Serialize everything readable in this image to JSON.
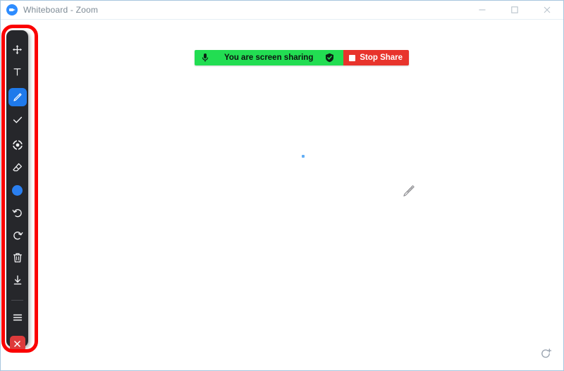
{
  "window": {
    "title": "Whiteboard - Zoom",
    "app_icon": "zoom-logo-icon",
    "controls": [
      {
        "name": "minimize",
        "glyph": "minimize-icon"
      },
      {
        "name": "maximize",
        "glyph": "maximize-icon"
      },
      {
        "name": "close",
        "glyph": "close-icon"
      }
    ]
  },
  "share_banner": {
    "mic_icon": "microphone-icon",
    "status_text": "You are screen sharing",
    "shield_icon": "shield-check-icon",
    "stop_icon": "stop-square-icon",
    "stop_label": "Stop Share",
    "green": "#22dd52",
    "red": "#e8342c"
  },
  "toolbar": {
    "highlight_color": "#fb0000",
    "active_color": "#1f7aeb",
    "current_color": "#2a7ff0",
    "items": [
      {
        "id": "select",
        "label": "Select",
        "icon": "move-icon",
        "active": false
      },
      {
        "id": "text",
        "label": "Text",
        "icon": "text-icon",
        "active": false
      },
      {
        "id": "draw",
        "label": "Draw",
        "icon": "pencil-icon",
        "active": true
      },
      {
        "id": "stamp",
        "label": "Stamp",
        "icon": "check-icon",
        "active": false
      },
      {
        "id": "spotlight",
        "label": "Spotlight",
        "icon": "spotlight-icon",
        "active": false
      },
      {
        "id": "eraser",
        "label": "Eraser",
        "icon": "eraser-icon",
        "active": false
      },
      {
        "id": "format",
        "label": "Format",
        "icon": "color-dot-icon",
        "active": false
      },
      {
        "id": "undo",
        "label": "Undo",
        "icon": "undo-icon",
        "active": false
      },
      {
        "id": "redo",
        "label": "Redo",
        "icon": "redo-icon",
        "active": false
      },
      {
        "id": "clear",
        "label": "Clear",
        "icon": "trash-icon",
        "active": false
      },
      {
        "id": "save",
        "label": "Save",
        "icon": "download-icon",
        "active": false
      },
      {
        "id": "more",
        "label": "More",
        "icon": "hamburger-icon",
        "active": false
      },
      {
        "id": "close",
        "label": "Close",
        "icon": "close-x-icon",
        "active": false
      }
    ]
  },
  "canvas": {
    "ink_mark": "blue-ink-dot",
    "cursor": "pencil-cursor",
    "add_page_icon": "new-page-icon"
  }
}
